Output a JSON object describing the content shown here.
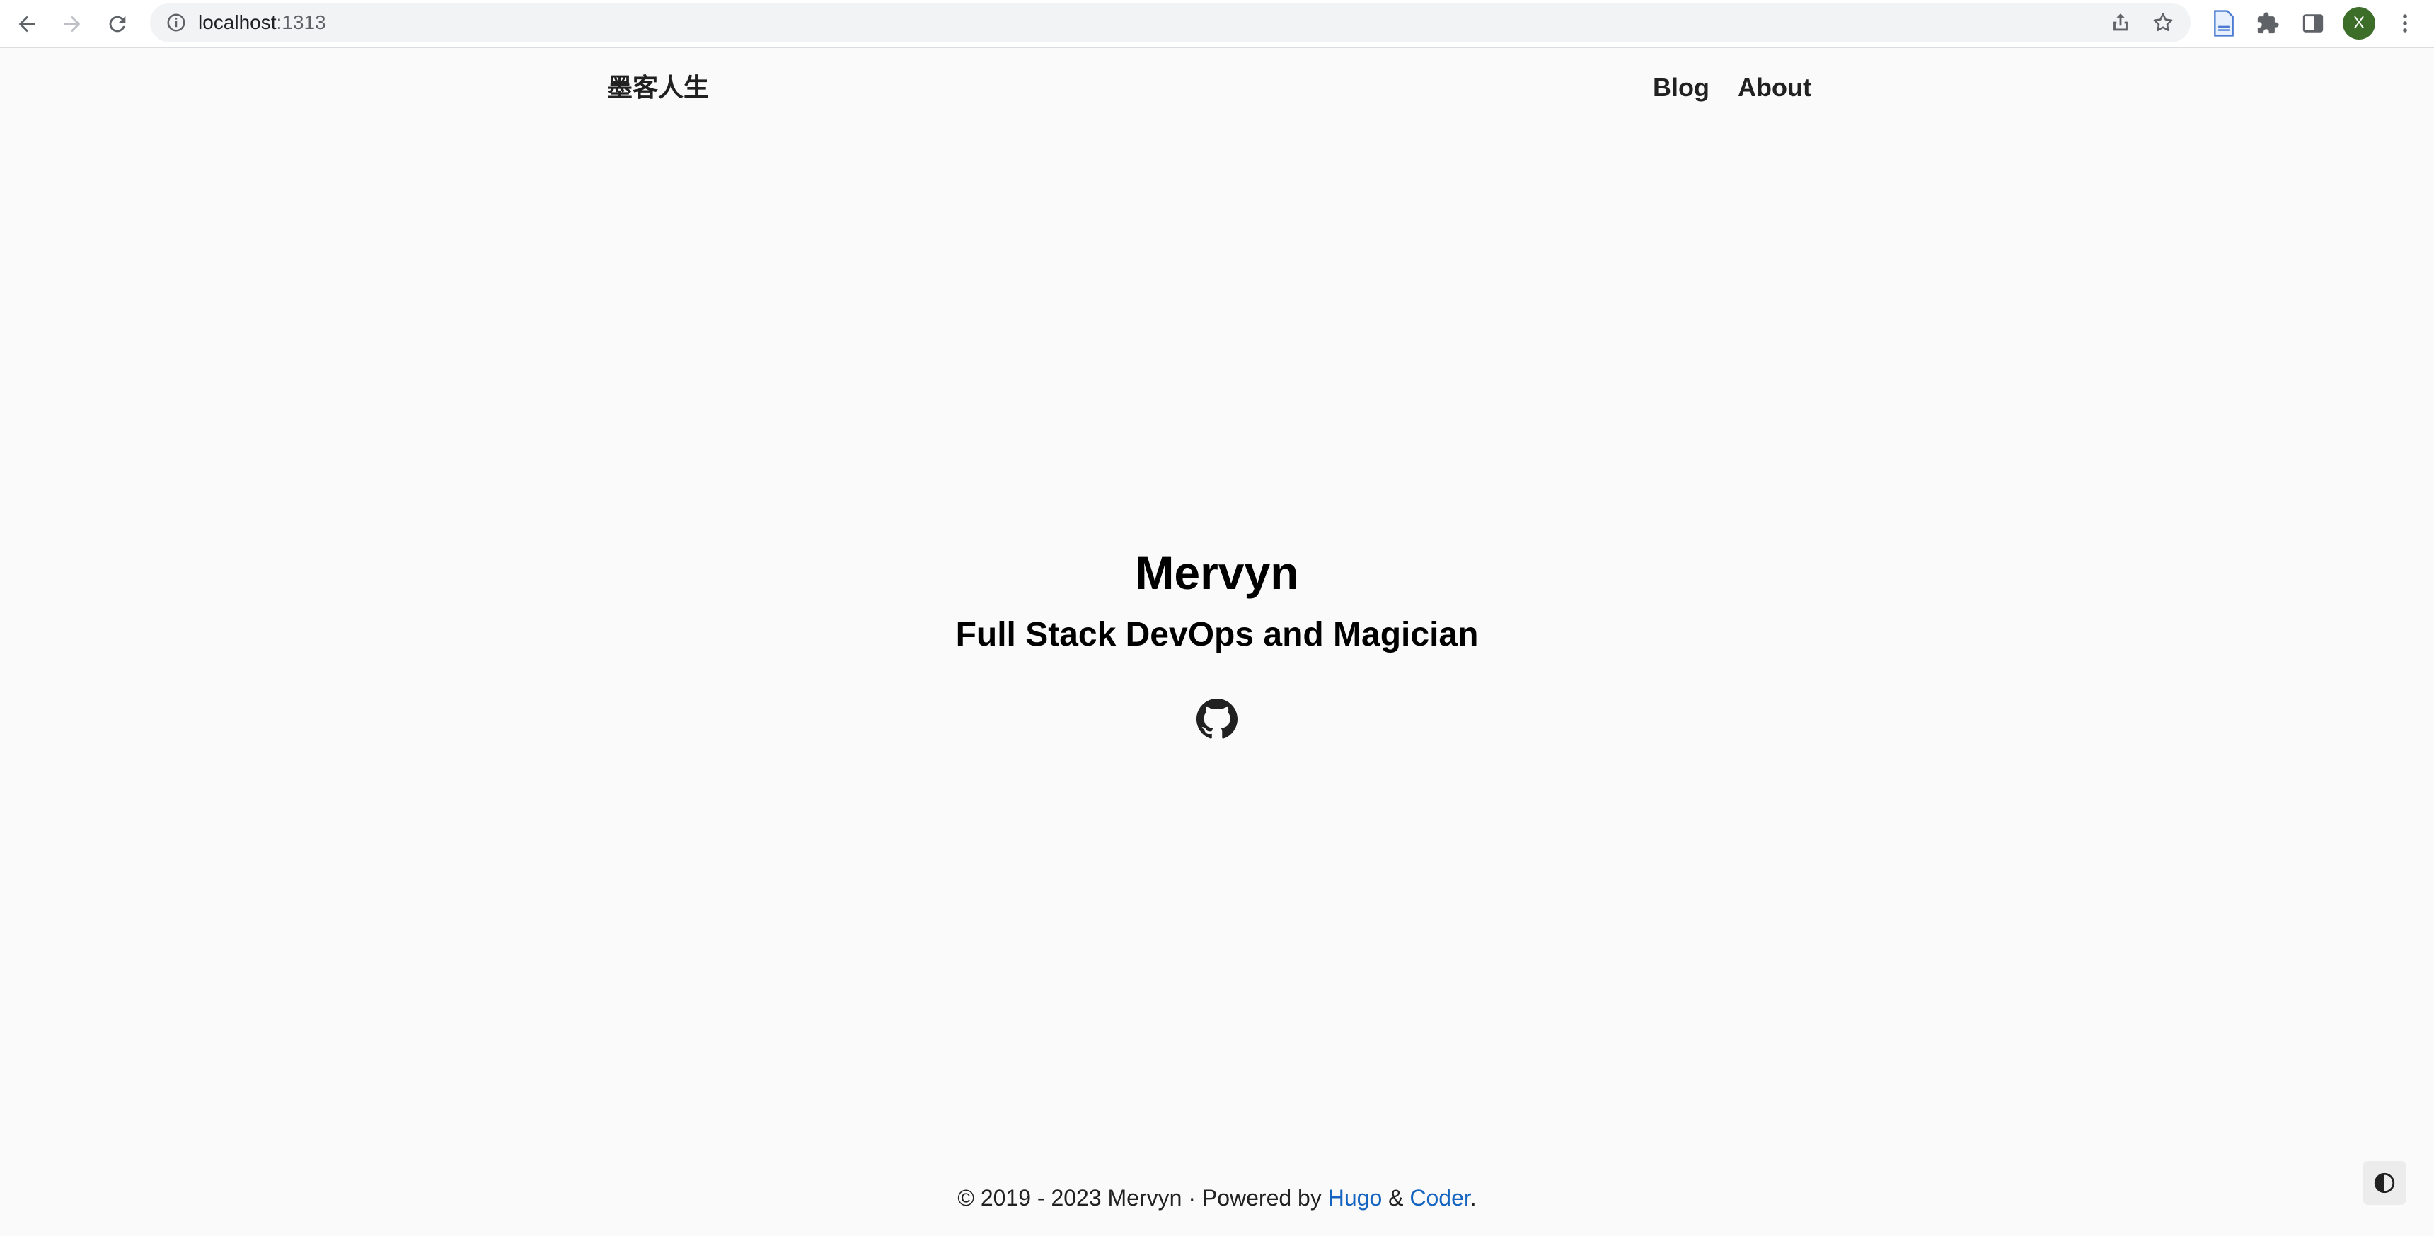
{
  "browser": {
    "url_host": "localhost",
    "url_port": ":1313",
    "profile_initial": "X",
    "icons": {
      "back": "arrow-left-icon",
      "forward": "arrow-right-icon",
      "reload": "reload-icon",
      "site_info": "info-icon",
      "share": "share-icon",
      "bookmark": "star-icon",
      "reader": "document-icon",
      "extensions": "puzzle-icon",
      "side_panel": "side-panel-icon",
      "menu": "kebab-menu-icon"
    }
  },
  "site": {
    "title": "墨客人生",
    "nav": [
      {
        "label": "Blog"
      },
      {
        "label": "About"
      }
    ]
  },
  "hero": {
    "name": "Mervyn",
    "tagline": "Full Stack DevOps and Magician",
    "social": [
      "github-icon"
    ]
  },
  "footer": {
    "prefix": "© 2019 - 2023 Mervyn · Powered by ",
    "link1": "Hugo",
    "separator": " & ",
    "link2": "Coder",
    "suffix": "."
  },
  "colors": {
    "page_bg": "#fafafa",
    "text": "#212121",
    "link": "#1565c0",
    "avatar_bg": "#3c6e2a"
  }
}
